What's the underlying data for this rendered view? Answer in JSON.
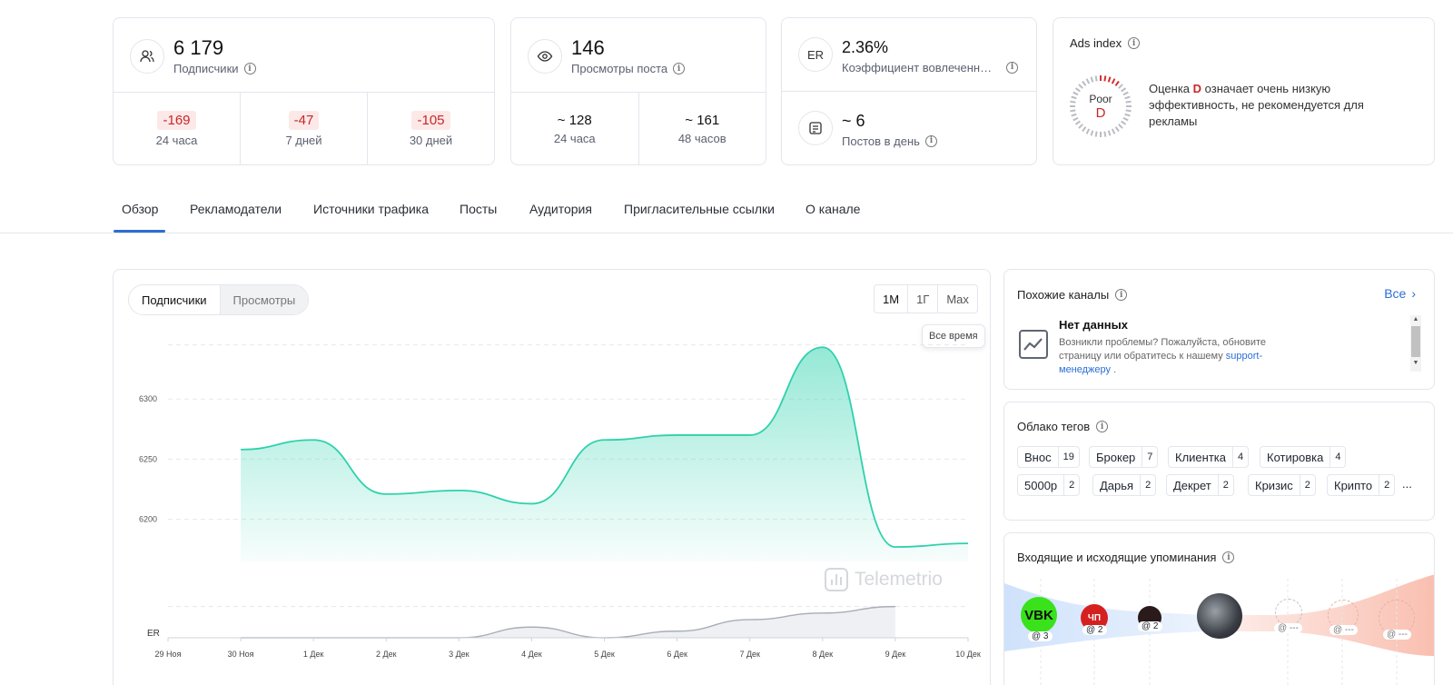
{
  "stats": {
    "subscribers": {
      "value": "6 179",
      "label": "Подписчики",
      "deltas": [
        {
          "value": "-169",
          "label": "24 часа"
        },
        {
          "value": "-47",
          "label": "7 дней"
        },
        {
          "value": "-105",
          "label": "30 дней"
        }
      ]
    },
    "views": {
      "value": "146",
      "label": "Просмотры поста",
      "cells": [
        {
          "value": "~ 128",
          "label": "24 часа"
        },
        {
          "value": "~ 161",
          "label": "48 часов"
        }
      ]
    },
    "er": {
      "icon_text": "ER",
      "value": "2.36%",
      "label": "Коэффициент вовлеченн…"
    },
    "posts": {
      "value": "~ 6",
      "label": "Постов в день"
    },
    "ads": {
      "title": "Ads index",
      "gauge_label": "Poor",
      "grade": "D",
      "score_fraction": 0.12,
      "desc_pre": "Оценка ",
      "desc_post": " означает очень низкую эффективность, не рекомендуется для рекламы"
    }
  },
  "tabs": [
    "Обзор",
    "Рекламодатели",
    "Источники трафика",
    "Посты",
    "Аудитория",
    "Пригласительные ссылки",
    "О канале"
  ],
  "chart_controls": {
    "segments": [
      "Подписчики",
      "Просмотры"
    ],
    "ranges": [
      "1М",
      "1Г",
      "Max"
    ],
    "tooltip": "Все время",
    "watermark": "Telemetrio"
  },
  "chart_data": {
    "type": "area",
    "x": [
      "29 Ноя",
      "30 Ноя",
      "1 Дек",
      "2 Дек",
      "3 Дек",
      "4 Дек",
      "5 Дек",
      "6 Дек",
      "7 Дек",
      "8 Дек",
      "9 Дек",
      "10 Дек"
    ],
    "series": [
      {
        "values": [
          null,
          6258,
          6266,
          6221,
          6224,
          6213,
          6266,
          6270,
          6270,
          6343,
          6177,
          6180
        ]
      }
    ],
    "y_ticks": [
      6200,
      6250,
      6300
    ],
    "ylim": [
      6165,
      6350
    ],
    "grid": true,
    "er_label": "ER",
    "er_values": [
      null,
      0.0,
      0.0,
      0.0,
      0.0,
      0.13,
      0.0,
      0.08,
      0.22,
      0.3,
      0.38,
      null
    ],
    "er_ylim": [
      0,
      0.42
    ]
  },
  "similar": {
    "title": "Похожие каналы",
    "all_link": "Все",
    "empty_title": "Нет данных",
    "empty_text": "Возникли проблемы? Пожалуйста, обновите страницу или обратитесь к нашему ",
    "support_link": "support-менеджеру",
    "empty_tail": " ."
  },
  "tags": {
    "title": "Облако тегов",
    "items": [
      {
        "name": "Внос",
        "count": "19"
      },
      {
        "name": "Брокер",
        "count": "7"
      },
      {
        "name": "Клиентка",
        "count": "4"
      },
      {
        "name": "Котировка",
        "count": "4"
      },
      {
        "name": "5000р",
        "count": "2"
      },
      {
        "name": "Дарья",
        "count": "2"
      },
      {
        "name": "Декрет",
        "count": "2"
      },
      {
        "name": "Кризис",
        "count": "2"
      },
      {
        "name": "Крипто",
        "count": "2"
      }
    ],
    "more": "..."
  },
  "mentions": {
    "title": "Входящие и исходящие упоминания",
    "incoming": [
      {
        "avatar": "VBK",
        "count": "@ 3",
        "color": "#39e21a"
      },
      {
        "avatar": "ЧП",
        "count": "@ 2",
        "color": "#d62020"
      },
      {
        "avatar": "",
        "count": "@ 2",
        "color": "#2a1a1a"
      }
    ],
    "outgoing": [
      "@ ---",
      "@ ---",
      "@ ---"
    ]
  }
}
